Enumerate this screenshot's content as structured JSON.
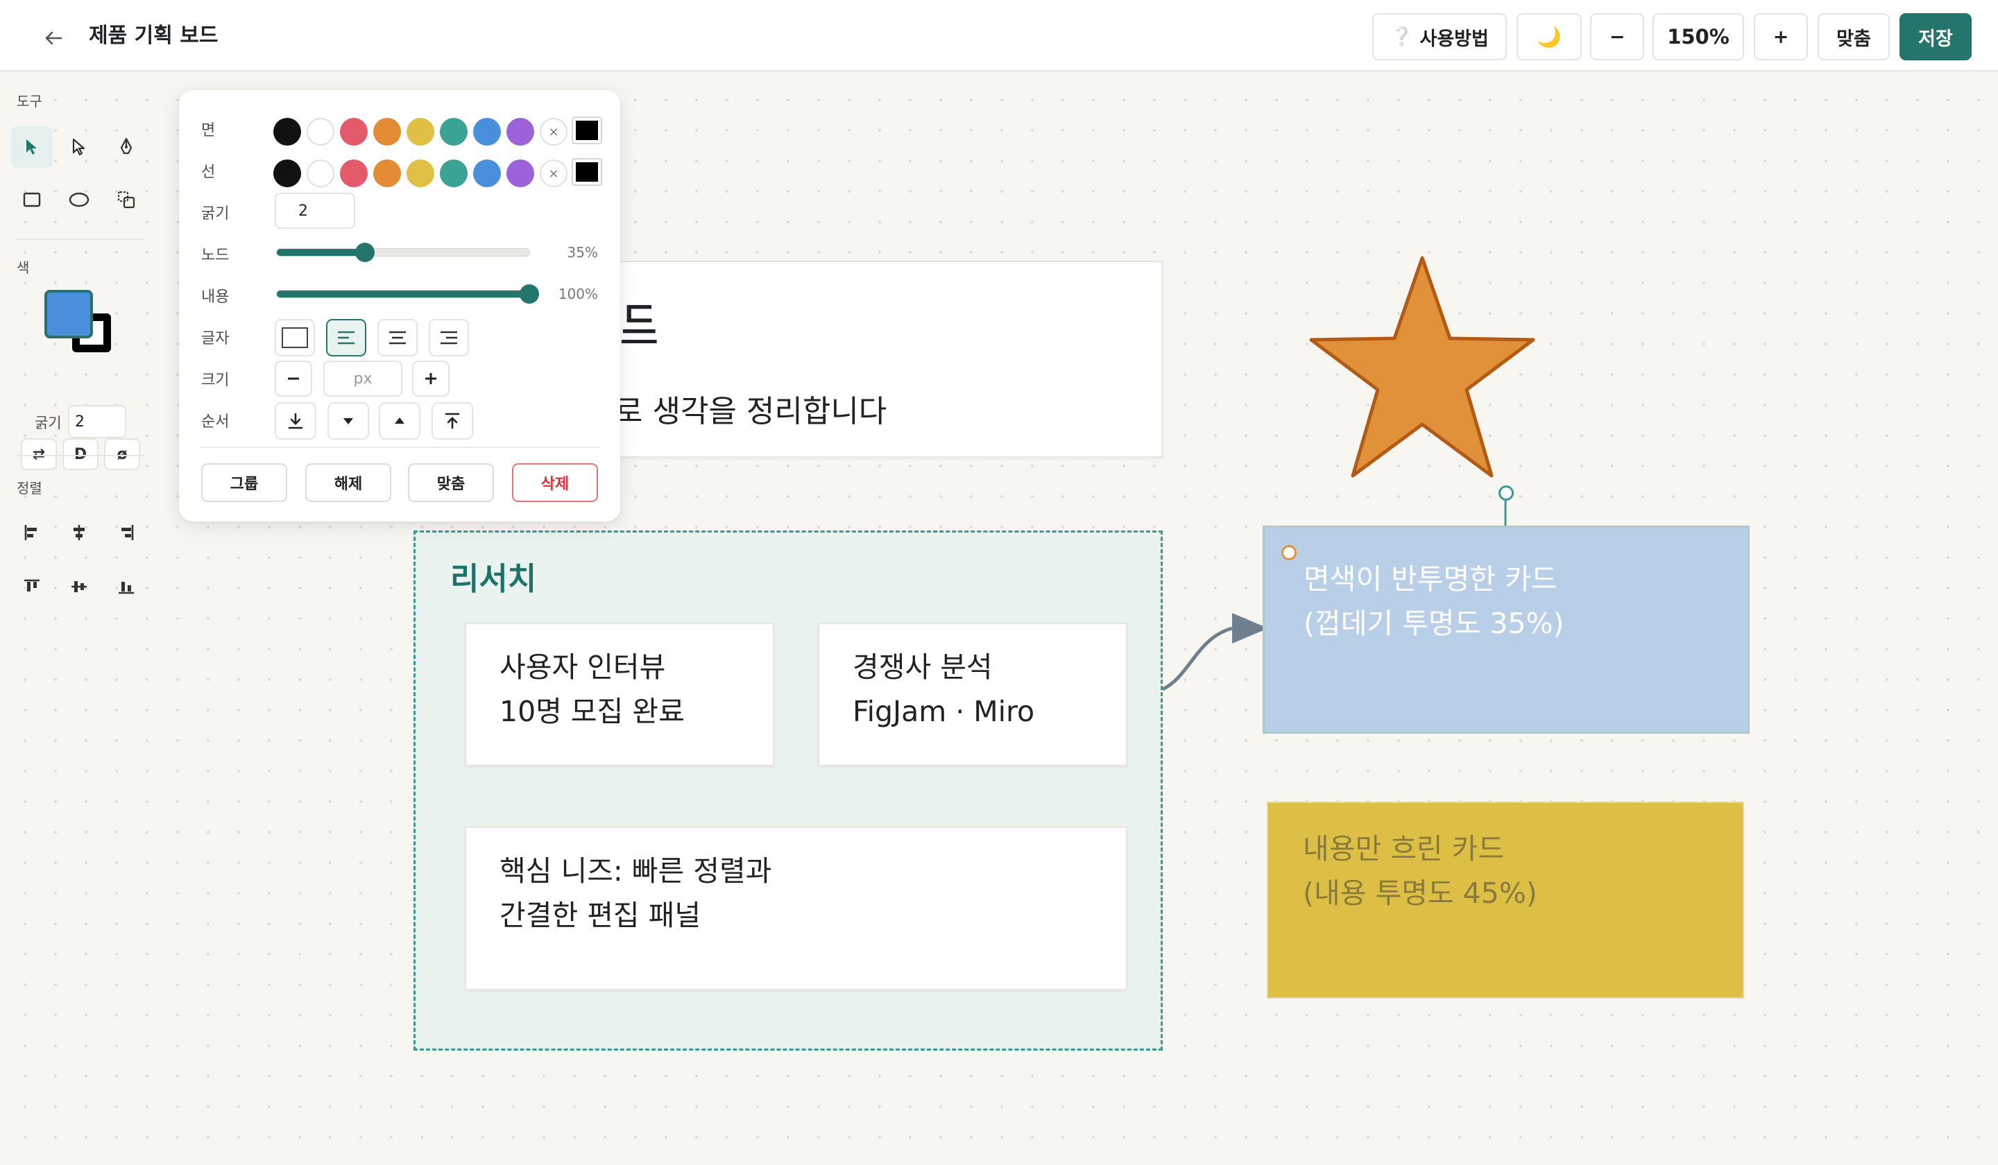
{
  "header": {
    "board_title": "제품 기획 보드",
    "help_label": "사용방법",
    "zoom_out_label": "−",
    "zoom_level": "150%",
    "zoom_in_label": "+",
    "fit_label": "맞춤",
    "save_label": "저장"
  },
  "sidebar": {
    "tools_heading": "도구",
    "color_heading": "색",
    "swap_label": "⇄",
    "default_label": "D",
    "none_label": "ø",
    "stroke_width_label": "굵기",
    "stroke_width_value": "2",
    "align_heading": "정렬",
    "fill_color": "#4a8fdc",
    "stroke_color": "#000000"
  },
  "panel": {
    "fill_label": "면",
    "stroke_label": "선",
    "stroke_width_label": "굵기",
    "stroke_width_value": "2",
    "node_opacity_label": "노드",
    "node_opacity": 35,
    "node_opacity_text": "35%",
    "content_opacity_label": "내용",
    "content_opacity": 100,
    "content_opacity_text": "100%",
    "text_align_label": "글자",
    "size_label": "크기",
    "size_placeholder": "px",
    "order_label": "순서",
    "none_swatch_label": "×",
    "palette": [
      "#111111",
      "#ffffff",
      "#e35b6b",
      "#e48b35",
      "#dfc045",
      "#3ba394",
      "#4a8fdc",
      "#9b62d9"
    ],
    "group_button": "그룹",
    "ungroup_button": "해제",
    "fit_button": "맞춤",
    "delete_button": "삭제"
  },
  "canvas": {
    "title_card_partial_heading": "드",
    "title_card_partial_text": "로 생각을 정리합니다",
    "group_title": "리서치",
    "card_interview_line1": "사용자 인터뷰",
    "card_interview_line2": "10명 모집 완료",
    "card_competitor_line1": "경쟁사 분석",
    "card_competitor_line2": "FigJam · Miro",
    "card_needs_line1": "핵심 니즈: 빠른 정렬과",
    "card_needs_line2": "간결한 편집 패널",
    "translucent_card_line1": "면색이 반투명한 카드",
    "translucent_card_line2": "(껍데기 투명도 35%)",
    "faded_card_line1": "내용만 흐린 카드",
    "faded_card_line2": "(내용 투명도 45%)",
    "star_fill": "#e0913a",
    "translucent_card_fill": "#b9cfe7",
    "faded_card_fill": "#ddbf45",
    "accent": "#24756b"
  }
}
